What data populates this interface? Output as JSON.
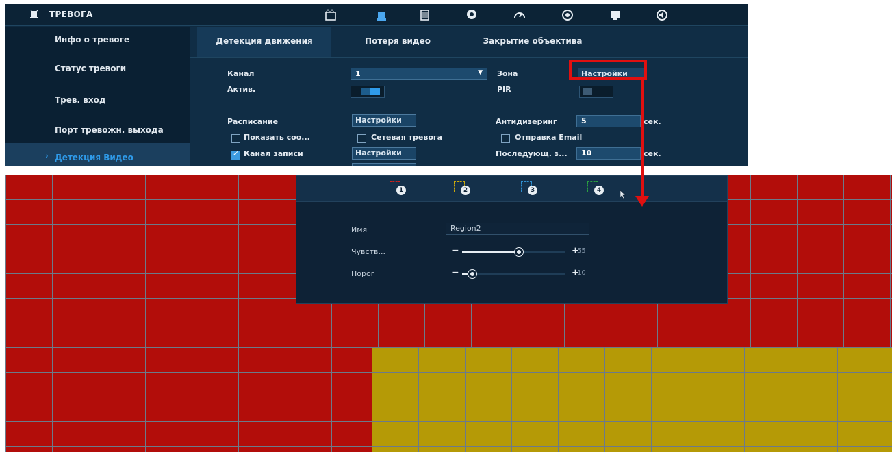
{
  "window": {
    "title": "ТРЕВОГА"
  },
  "top_icons": [
    "clapperboard-icon",
    "alarm-icon",
    "storage-icon",
    "brain-icon",
    "gauge-icon",
    "disc-icon",
    "monitor-icon",
    "speaker-icon"
  ],
  "sidebar": {
    "items": [
      {
        "label": "Инфо о тревоге"
      },
      {
        "label": "Статус тревоги"
      },
      {
        "label": "Трев. вход"
      },
      {
        "label": "Порт тревожн. выхода"
      },
      {
        "label": "Детекция Видео",
        "active": true
      }
    ]
  },
  "tabs": [
    {
      "label": "Детекция движения",
      "active": true
    },
    {
      "label": "Потеря видео"
    },
    {
      "label": "Закрытие объектива"
    }
  ],
  "form": {
    "channel_label": "Канал",
    "channel_value": "1",
    "zone_label": "Зона",
    "zone_button": "Настройки",
    "active_label": "Актив.",
    "active_on": true,
    "pir_label": "PIR",
    "pir_on": false,
    "schedule_label": "Расписание",
    "schedule_button": "Настройки",
    "antidither_label": "Антидизеринг",
    "antidither_value": "5",
    "antidither_unit": "сек.",
    "show_message_label": "Показать соо...",
    "show_message_checked": false,
    "net_alarm_label": "Сетевая тревога",
    "net_alarm_checked": false,
    "email_label": "Отправка Email",
    "email_checked": false,
    "record_channel_label": "Канал записи",
    "record_channel_checked": true,
    "record_channel_button": "Настройки",
    "post_record_label": "Последующ. з...",
    "post_record_value": "10",
    "post_record_unit": "сек."
  },
  "region_panel": {
    "regions": [
      {
        "number": "1",
        "color": "#d0201a"
      },
      {
        "number": "2",
        "color": "#c9a80c"
      },
      {
        "number": "3",
        "color": "#2f8fd0"
      },
      {
        "number": "4",
        "color": "#2aa040"
      }
    ],
    "name_label": "Имя",
    "name_value": "Region2",
    "sensitivity_label": "Чувств...",
    "sensitivity_value": "55",
    "threshold_label": "Порог",
    "threshold_value": "10",
    "sensitivity_fraction": 0.55,
    "threshold_fraction": 0.1
  },
  "colors": {
    "zone_red": "#b20d0a",
    "zone_yellow": "#b59a06",
    "highlight": "#e01010",
    "accent": "#2f9bea"
  }
}
